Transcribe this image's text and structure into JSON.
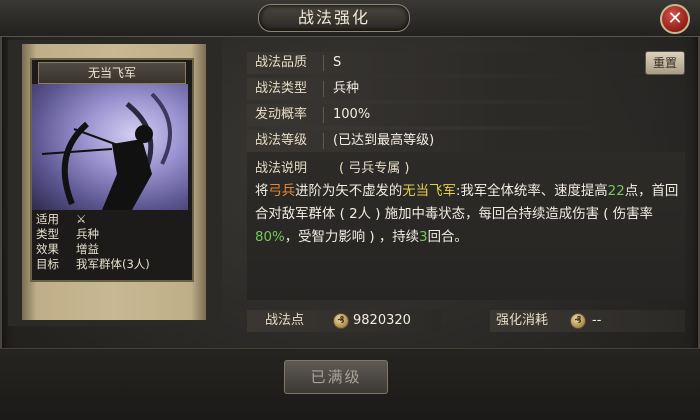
{
  "window": {
    "title": "战法强化",
    "close_icon": "close-icon"
  },
  "card": {
    "name": "无当飞军",
    "stats": [
      {
        "key": "适用",
        "value": "",
        "icon": "crossed-bows-icon"
      },
      {
        "key": "类型",
        "value": "兵种"
      },
      {
        "key": "效果",
        "value": "增益"
      },
      {
        "key": "目标",
        "value": "我军群体(3人)"
      }
    ]
  },
  "info": {
    "quality_label": "战法品质",
    "quality_value": "S",
    "type_label": "战法类型",
    "type_value": "兵种",
    "rate_label": "发动概率",
    "rate_value": "100%",
    "level_label": "战法等级",
    "level_value": "(已达到最高等级)",
    "reset_label": "重置"
  },
  "description": {
    "head": "战法说明",
    "sub": "( 弓兵专属 )",
    "parts": {
      "p1": "将",
      "p2": "弓兵",
      "p3": "进阶为矢不虚发的",
      "p4": "无当飞军",
      "p5": ":我军全体统率、速度提高",
      "p6": "22",
      "p7": "点，首回合对敌军群体 ( 2人 ) 施加中毒状态，每回合持续造成伤害 ( 伤害率",
      "p8": "80%",
      "p9": "，受智力影响 ) ，持续",
      "p10": "3",
      "p11": "回合。"
    }
  },
  "points": {
    "label": "战法点",
    "value": "9820320"
  },
  "cost": {
    "label": "强化消耗",
    "value": "--"
  },
  "action": {
    "label": "已满级"
  },
  "colors": {
    "accent_orange": "#e38a36",
    "accent_yellow": "#e2cf4a",
    "accent_green": "#76c85b"
  }
}
